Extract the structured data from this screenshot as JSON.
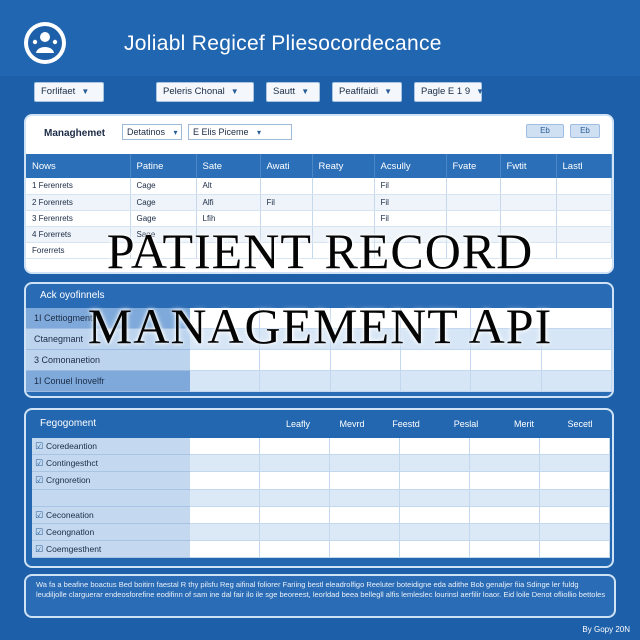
{
  "app": {
    "title": "Joliabl Regicef Pliesocordecance"
  },
  "filters": [
    {
      "label": "Forlifaet"
    },
    {
      "label": "Peleris Chonal"
    },
    {
      "label": "Sautt"
    },
    {
      "label": "Peafifaidi"
    },
    {
      "label": "Pagle E 1 9"
    }
  ],
  "records_panel": {
    "title": "Managhemet",
    "select_a": "Detatinos",
    "select_b": "E Elis Piceme",
    "tool_a": "Eb",
    "tool_b": "Eb",
    "columns": [
      "Nows",
      "Patine",
      "Sate",
      "Awati",
      "Reaty",
      "Acsully",
      "Fvate",
      "Fwtit",
      "Lastl"
    ],
    "rows": [
      [
        "1 Ferenrets",
        "Cage",
        "Alt",
        "",
        "",
        "Fil",
        "",
        "",
        ""
      ],
      [
        "2 Forenrets",
        "Cage",
        "Alfi",
        "Fil",
        "",
        "Fil",
        "",
        "",
        ""
      ],
      [
        "3 Ferenrets",
        "Gage",
        "Lfih",
        "",
        "",
        "Fil",
        "",
        "",
        ""
      ],
      [
        "4 Forerrets",
        "Sage",
        "",
        "",
        "",
        "",
        "",
        "",
        ""
      ],
      [
        "Forerrets",
        "",
        "",
        "",
        "",
        "",
        "",
        "",
        ""
      ]
    ]
  },
  "config_panel": {
    "title": "Ack oyofinnels",
    "rows": [
      {
        "label": "1I Cettiogment"
      },
      {
        "label": "Ctanegmant"
      },
      {
        "label": "3 Comonanetion"
      },
      {
        "label": "1I Conuel Inovelfr"
      }
    ]
  },
  "grouping_panel": {
    "title": "Fegogoment",
    "columns": [
      "Leafly",
      "Mevrd",
      "Feestd",
      "Peslal",
      "Merit",
      "Secetl"
    ],
    "rows": [
      {
        "label": "Coredeantion",
        "checked": true
      },
      {
        "label": "Contingesthct",
        "checked": true
      },
      {
        "label": "Crgnoretion",
        "checked": true
      },
      {
        "label": "",
        "checked": false
      },
      {
        "label": "Ceconeation",
        "checked": true
      },
      {
        "label": "Ceongnatlon",
        "checked": true
      },
      {
        "label": "Coemgesthent",
        "checked": true
      }
    ]
  },
  "footer": {
    "notes": "Wa fa a beafine boactus Bed boitirn faestal R thy pilsfu Reg aifinal foliorer Fariing bestl eleadrolfigo Reeluter boteidigne eda adithe Bob genaljer fiia Sdinge ler fuldg leudiljolle clarguerar endeosforefine eodifinn of sam ine dal fair ilo ile sge beoreest, leorldad beea bellegll alfis lemleslec lourinsl aerfilir loaor. Eid loile Denot ofliollio bettoles",
    "copyright": "By Gopy 20N"
  },
  "overlay": {
    "line1": "PATIENT RECORD",
    "line2": "MANAGEMENT API"
  },
  "colors": {
    "brand_blue": "#2166b0",
    "table_header": "#2b6fb8",
    "panel_light": "#bcd4ee"
  }
}
